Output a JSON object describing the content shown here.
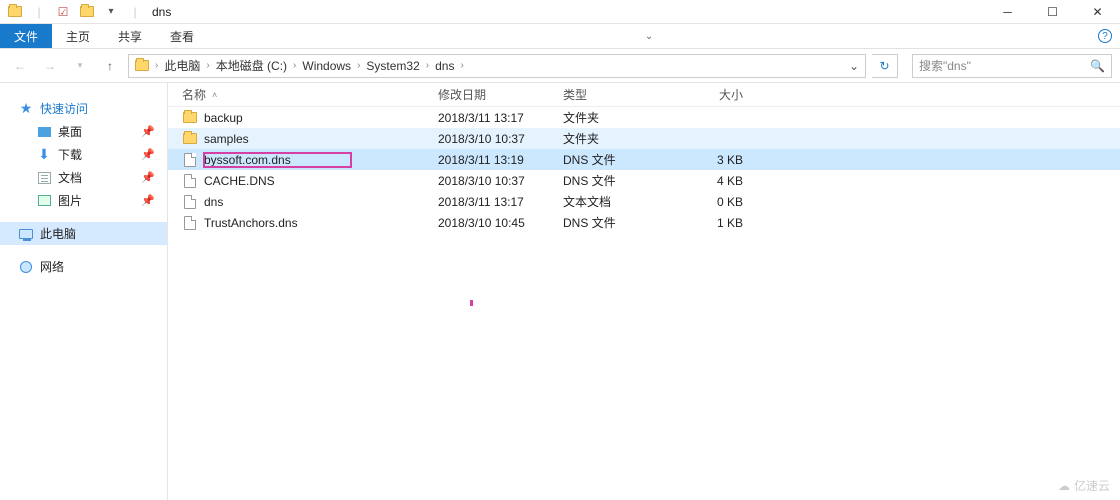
{
  "window": {
    "title": "dns"
  },
  "ribbon": {
    "file": "文件",
    "tabs": [
      "主页",
      "共享",
      "查看"
    ]
  },
  "breadcrumb": {
    "items": [
      "此电脑",
      "本地磁盘 (C:)",
      "Windows",
      "System32",
      "dns"
    ]
  },
  "search": {
    "placeholder": "搜索\"dns\""
  },
  "sidebar": {
    "quick": {
      "label": "快速访问",
      "items": [
        {
          "label": "桌面",
          "icon": "desktop"
        },
        {
          "label": "下载",
          "icon": "download"
        },
        {
          "label": "文档",
          "icon": "document"
        },
        {
          "label": "图片",
          "icon": "picture"
        }
      ]
    },
    "thispc": {
      "label": "此电脑"
    },
    "network": {
      "label": "网络"
    }
  },
  "columns": {
    "name": "名称",
    "date": "修改日期",
    "type": "类型",
    "size": "大小"
  },
  "files": [
    {
      "name": "backup",
      "date": "2018/3/11 13:17",
      "type": "文件夹",
      "size": "",
      "icon": "folder",
      "state": ""
    },
    {
      "name": "samples",
      "date": "2018/3/10 10:37",
      "type": "文件夹",
      "size": "",
      "icon": "folder",
      "state": "hot"
    },
    {
      "name": "byssoft.com.dns",
      "date": "2018/3/11 13:19",
      "type": "DNS 文件",
      "size": "3 KB",
      "icon": "file",
      "state": "sel highlighted"
    },
    {
      "name": "CACHE.DNS",
      "date": "2018/3/10 10:37",
      "type": "DNS 文件",
      "size": "4 KB",
      "icon": "file",
      "state": ""
    },
    {
      "name": "dns",
      "date": "2018/3/11 13:17",
      "type": "文本文档",
      "size": "0 KB",
      "icon": "file",
      "state": ""
    },
    {
      "name": "TrustAnchors.dns",
      "date": "2018/3/10 10:45",
      "type": "DNS 文件",
      "size": "1 KB",
      "icon": "file",
      "state": ""
    }
  ],
  "watermark": "亿速云"
}
